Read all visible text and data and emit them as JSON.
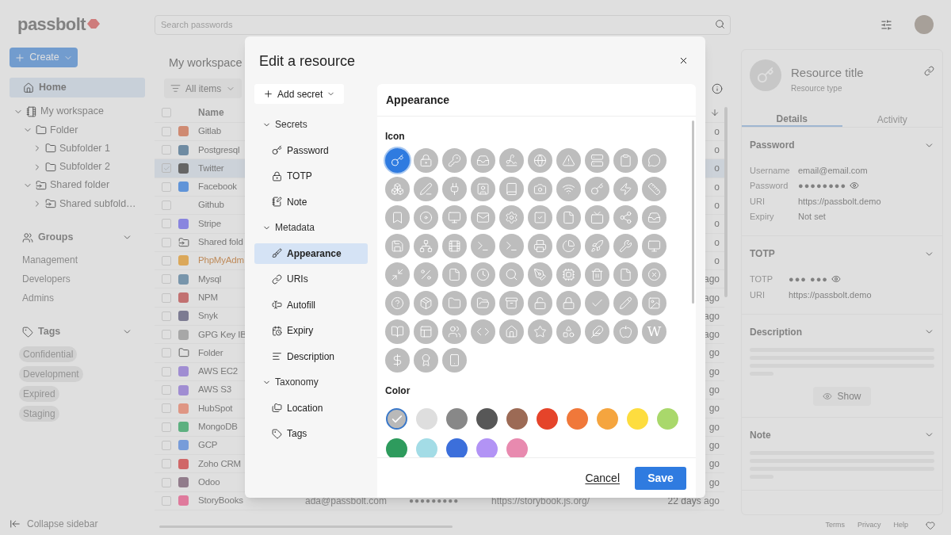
{
  "app": {
    "logo": "passbolt"
  },
  "search": {
    "placeholder": "Search passwords"
  },
  "sidebar": {
    "create": "Create",
    "home": {
      "label": "Home",
      "selected": true
    },
    "tree": [
      {
        "label": "My workspace",
        "kind": "workspace",
        "expanded": true,
        "children": [
          {
            "label": "Folder",
            "kind": "folder",
            "expanded": true,
            "children": [
              {
                "label": "Subfolder 1",
                "kind": "folder",
                "expanded": false
              },
              {
                "label": "Subfolder 2",
                "kind": "folder",
                "expanded": false
              }
            ]
          },
          {
            "label": "Shared folder",
            "kind": "shared",
            "expanded": true,
            "children": [
              {
                "label": "Shared subfold…",
                "kind": "shared",
                "expanded": false
              }
            ]
          }
        ]
      }
    ],
    "groups": {
      "title": "Groups",
      "expanded": true,
      "items": [
        "Management",
        "Developers",
        "Admins"
      ]
    },
    "tags": {
      "title": "Tags",
      "expanded": true,
      "items": [
        "Confidential",
        "Development",
        "Expired",
        "Staging"
      ]
    },
    "collapse": "Collapse sidebar"
  },
  "workspace": {
    "title": "My workspace",
    "filter": "All items",
    "column_name": "Name",
    "all_selected": false,
    "rows": [
      {
        "name": "Gitlab",
        "kind": "logo",
        "selected": false,
        "expired": false,
        "modified": "o"
      },
      {
        "name": "Postgresql",
        "kind": "logo",
        "selected": false,
        "expired": false,
        "modified": "o"
      },
      {
        "name": "Twitter",
        "kind": "logo",
        "selected": true,
        "expired": false,
        "modified": "o"
      },
      {
        "name": "Facebook",
        "kind": "logo",
        "selected": false,
        "expired": false,
        "modified": "o"
      },
      {
        "name": "Github",
        "kind": "none",
        "selected": false,
        "expired": false,
        "modified": "o"
      },
      {
        "name": "Stripe",
        "kind": "logo",
        "selected": false,
        "expired": false,
        "modified": "o"
      },
      {
        "name": "Shared fold",
        "kind": "shared",
        "selected": false,
        "expired": false,
        "modified": "o"
      },
      {
        "name": "PhpMyAdm",
        "kind": "logo",
        "selected": false,
        "expired": true,
        "modified": "o"
      },
      {
        "name": "Mysql",
        "kind": "logo",
        "selected": false,
        "expired": false,
        "modified": "ago"
      },
      {
        "name": "NPM",
        "kind": "logo",
        "selected": false,
        "expired": false,
        "modified": "ago"
      },
      {
        "name": "Snyk",
        "kind": "logo",
        "selected": false,
        "expired": false,
        "modified": "ago"
      },
      {
        "name": "GPG Key IB",
        "kind": "logo",
        "selected": false,
        "expired": false,
        "modified": "ago"
      },
      {
        "name": "Folder",
        "kind": "folder",
        "selected": false,
        "expired": false,
        "modified": "go"
      },
      {
        "name": "AWS EC2",
        "kind": "logo",
        "selected": false,
        "expired": false,
        "modified": "go"
      },
      {
        "name": "AWS S3",
        "kind": "logo",
        "selected": false,
        "expired": false,
        "modified": "go"
      },
      {
        "name": "HubSpot",
        "kind": "logo",
        "selected": false,
        "expired": false,
        "modified": "go"
      },
      {
        "name": "MongoDB",
        "kind": "logo",
        "selected": false,
        "expired": false,
        "modified": "go"
      },
      {
        "name": "GCP",
        "kind": "logo",
        "selected": false,
        "expired": false,
        "modified": "go"
      },
      {
        "name": "Zoho CRM",
        "kind": "logo",
        "selected": false,
        "expired": false,
        "modified": "go"
      },
      {
        "name": "Odoo",
        "kind": "logo",
        "selected": false,
        "expired": false,
        "modified": "go"
      },
      {
        "name": "StoryBooks",
        "kind": "logo",
        "selected": false,
        "expired": false,
        "username": "ada@passbolt.com",
        "password": "●●●●●●●●●",
        "uri": "https://storybook.js.org/",
        "modified": "22 days ago"
      }
    ]
  },
  "details": {
    "title": "Resource title",
    "subtitle": "Resource type",
    "tabs": [
      {
        "label": "Details",
        "selected": true
      },
      {
        "label": "Activity",
        "selected": false
      }
    ],
    "sections": [
      {
        "title": "Password",
        "kind": "fields",
        "fields": [
          {
            "label": "Username",
            "value": "email@email.com",
            "secret": false
          },
          {
            "label": "Password",
            "value": "●●●●●●●●",
            "secret": true
          },
          {
            "label": "URI",
            "value": "https://passbolt.demo",
            "secret": false
          },
          {
            "label": "Expiry",
            "value": "Not set",
            "secret": false
          }
        ]
      },
      {
        "title": "TOTP",
        "kind": "fields",
        "fields": [
          {
            "label": "TOTP",
            "value": "●●● ●●●",
            "secret": true
          },
          {
            "label": "URI",
            "value": "https://passbolt.demo",
            "secret": false
          }
        ]
      },
      {
        "title": "Description",
        "kind": "hidden",
        "button": "Show"
      },
      {
        "title": "Note",
        "kind": "hidden"
      }
    ]
  },
  "footer": [
    "Terms",
    "Privacy",
    "Help"
  ],
  "modal": {
    "title": "Edit a resource",
    "add_secret": "Add secret",
    "nav": [
      {
        "title": "Secrets",
        "expanded": true,
        "items": [
          {
            "label": "Password",
            "selected": false
          },
          {
            "label": "TOTP",
            "selected": false
          },
          {
            "label": "Note",
            "selected": false
          }
        ]
      },
      {
        "title": "Metadata",
        "expanded": true,
        "items": [
          {
            "label": "Appearance",
            "selected": true
          },
          {
            "label": "URIs",
            "selected": false
          },
          {
            "label": "Autofill",
            "selected": false
          },
          {
            "label": "Expiry",
            "selected": false
          },
          {
            "label": "Description",
            "selected": false
          }
        ]
      },
      {
        "title": "Taxonomy",
        "expanded": true,
        "items": [
          {
            "label": "Location",
            "selected": false
          },
          {
            "label": "Tags",
            "selected": false
          }
        ]
      }
    ],
    "panel_title": "Appearance",
    "icon_label": "Icon",
    "color_label": "Color",
    "icons": [
      {
        "selected": true
      },
      {
        "selected": false
      },
      {
        "selected": false
      },
      {
        "selected": false
      },
      {
        "selected": false
      },
      {
        "selected": false
      },
      {
        "selected": false
      },
      {
        "selected": false
      },
      {
        "selected": false
      },
      {
        "selected": false
      },
      {
        "selected": false
      },
      {
        "selected": false
      },
      {
        "selected": false
      },
      {
        "selected": false
      },
      {
        "selected": false
      },
      {
        "selected": false
      },
      {
        "selected": false
      },
      {
        "selected": false
      },
      {
        "selected": false
      },
      {
        "selected": false
      },
      {
        "selected": false
      },
      {
        "selected": false
      },
      {
        "selected": false
      },
      {
        "selected": false
      },
      {
        "selected": false
      },
      {
        "selected": false
      },
      {
        "selected": false
      },
      {
        "selected": false
      },
      {
        "selected": false
      },
      {
        "selected": false
      },
      {
        "selected": false
      },
      {
        "selected": false
      },
      {
        "selected": false
      },
      {
        "selected": false
      },
      {
        "selected": false
      },
      {
        "selected": false
      },
      {
        "selected": false
      },
      {
        "selected": false
      },
      {
        "selected": false
      },
      {
        "selected": false
      },
      {
        "selected": false
      },
      {
        "selected": false
      },
      {
        "selected": false
      },
      {
        "selected": false
      },
      {
        "selected": false
      },
      {
        "selected": false
      },
      {
        "selected": false
      },
      {
        "selected": false
      },
      {
        "selected": false
      },
      {
        "selected": false
      },
      {
        "selected": false
      },
      {
        "selected": false
      },
      {
        "selected": false
      },
      {
        "selected": false
      },
      {
        "selected": false
      },
      {
        "selected": false
      },
      {
        "selected": false
      },
      {
        "selected": false
      },
      {
        "selected": false
      },
      {
        "selected": false
      },
      {
        "selected": false
      },
      {
        "selected": false
      },
      {
        "selected": false
      },
      {
        "selected": false
      },
      {
        "selected": false
      },
      {
        "selected": false
      },
      {
        "selected": false
      },
      {
        "selected": false
      },
      {
        "selected": false
      },
      {
        "selected": false,
        "glyph": "W"
      },
      {
        "selected": false
      },
      {
        "selected": false
      },
      {
        "selected": false
      }
    ],
    "colors": [
      {
        "color": "#b9b9b9",
        "selected": true
      },
      {
        "color": "#dedede",
        "selected": false
      },
      {
        "color": "#888888",
        "selected": false
      },
      {
        "color": "#575757",
        "selected": false
      },
      {
        "color": "#9c6a55",
        "selected": false
      },
      {
        "color": "#e5442a",
        "selected": false
      },
      {
        "color": "#f0783a",
        "selected": false
      },
      {
        "color": "#f5a53f",
        "selected": false
      },
      {
        "color": "#fddd3f",
        "selected": false
      },
      {
        "color": "#a9d86b",
        "selected": false
      },
      {
        "color": "#2e9b5d",
        "selected": false
      },
      {
        "color": "#a3dce6",
        "selected": false
      },
      {
        "color": "#3c6fdb",
        "selected": false
      },
      {
        "color": "#b293f5",
        "selected": false
      },
      {
        "color": "#e88aaf",
        "selected": false
      }
    ],
    "cancel": "Cancel",
    "save": "Save"
  }
}
